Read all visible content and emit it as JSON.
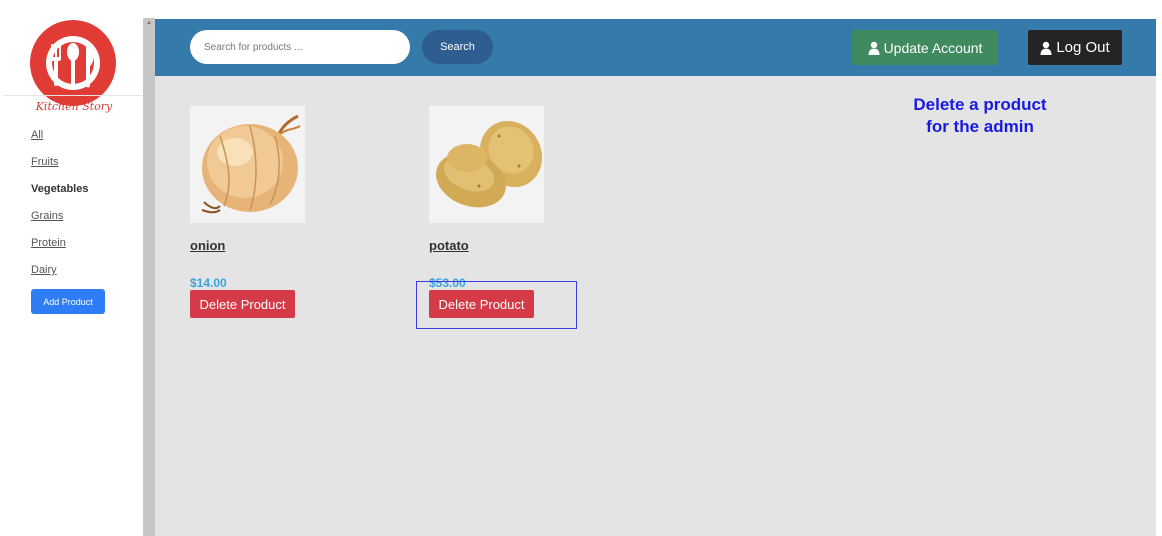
{
  "sidebar": {
    "brand": "Kitchen Story",
    "categories": [
      {
        "label": "All"
      },
      {
        "label": "Fruits"
      },
      {
        "label": "Vegetables"
      },
      {
        "label": "Grains"
      },
      {
        "label": "Protein"
      },
      {
        "label": "Dairy"
      }
    ],
    "add_button_label": "Add Product"
  },
  "header": {
    "search_placeholder": "Search for products ...",
    "search_button_label": "Search",
    "update_account_label": "Update Account",
    "logout_label": "Log Out"
  },
  "annotation": {
    "line1": "Delete a product",
    "line2": "for the admin"
  },
  "products": [
    {
      "name": "onion",
      "price": "$14.00",
      "delete_label": "Delete Product",
      "image_icon": "onion-image"
    },
    {
      "name": "potato",
      "price": "$53.00",
      "delete_label": "Delete Product",
      "image_icon": "potato-image"
    }
  ],
  "colors": {
    "header_bg": "#347aaa",
    "delete_button": "#d43a48",
    "price_text": "#3aa3df",
    "annotation_text": "#1a1adf",
    "update_button": "#3f8a5e",
    "logout_button": "#242424"
  }
}
